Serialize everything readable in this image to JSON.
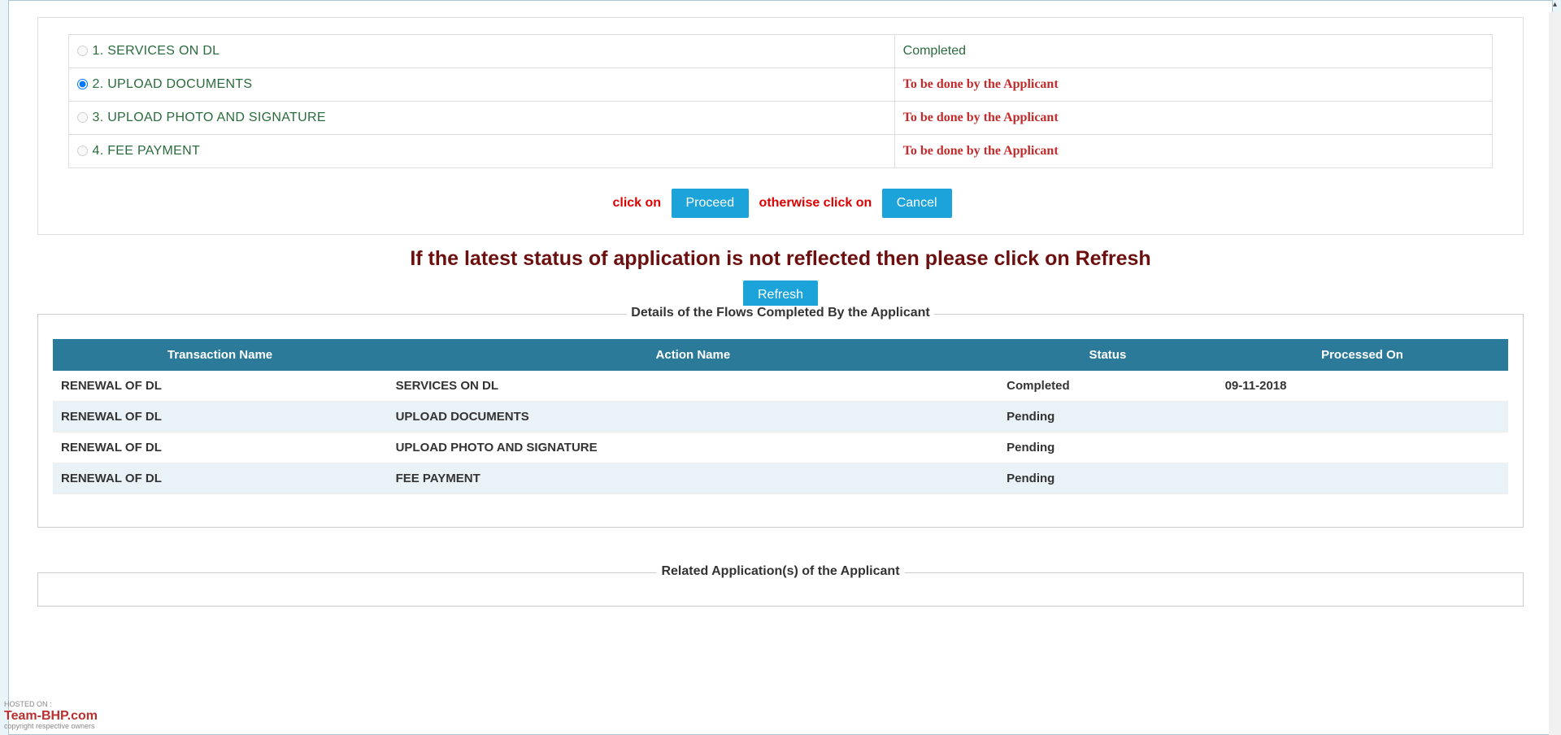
{
  "steps": {
    "items": [
      {
        "label": "1.  SERVICES ON DL",
        "status": "Completed",
        "status_class": "status-completed",
        "selected": false
      },
      {
        "label": "2.  UPLOAD DOCUMENTS",
        "status": "To be done by the Applicant",
        "status_class": "status-todo",
        "selected": true
      },
      {
        "label": "3.  UPLOAD PHOTO AND SIGNATURE",
        "status": "To be done by the Applicant",
        "status_class": "status-todo",
        "selected": false
      },
      {
        "label": "4.  FEE PAYMENT",
        "status": "To be done by the Applicant",
        "status_class": "status-todo",
        "selected": false
      }
    ]
  },
  "actions": {
    "click_on": "click on",
    "proceed": "Proceed",
    "otherwise": "otherwise click on",
    "cancel": "Cancel"
  },
  "refresh_notice": "If the latest status of application is not reflected then please click on Refresh",
  "refresh_btn": "Refresh",
  "details": {
    "legend": "Details of the Flows Completed By the Applicant",
    "headers": {
      "transaction": "Transaction Name",
      "action": "Action Name",
      "status": "Status",
      "processed": "Processed On"
    },
    "rows": [
      {
        "transaction": "RENEWAL OF DL",
        "action": "SERVICES ON DL",
        "status": "Completed",
        "processed": "09-11-2018"
      },
      {
        "transaction": "RENEWAL OF DL",
        "action": "UPLOAD DOCUMENTS",
        "status": "Pending",
        "processed": ""
      },
      {
        "transaction": "RENEWAL OF DL",
        "action": "UPLOAD PHOTO AND SIGNATURE",
        "status": "Pending",
        "processed": ""
      },
      {
        "transaction": "RENEWAL OF DL",
        "action": "FEE PAYMENT",
        "status": "Pending",
        "processed": ""
      }
    ]
  },
  "related_legend": "Related Application(s) of the Applicant",
  "watermark": {
    "hosted": "HOSTED ON :",
    "logo": "Team-BHP.com",
    "sub": "copyright respective owners"
  }
}
